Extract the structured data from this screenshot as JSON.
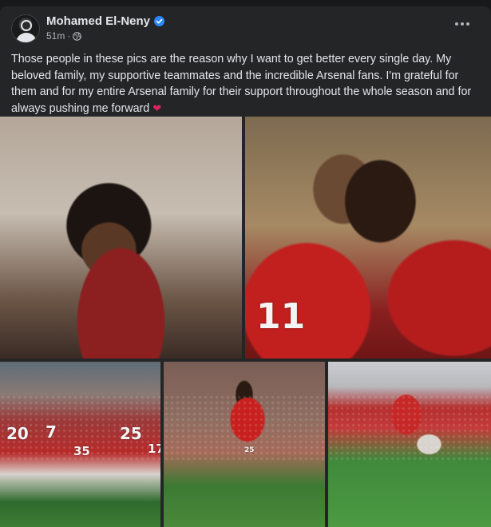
{
  "post": {
    "author": "Mohamed El-Neny",
    "time": "51m",
    "audience_icon": "globe-icon",
    "verified_icon": "verified-badge-icon",
    "text": "Those people in these pics are the reason why I want to get better every single day. My beloved family, my supportive teammates and the incredible Arsenal fans. I'm grateful for them and for my entire Arsenal family for their support throughout the whole season and for always pushing me forward",
    "emoji": "❤",
    "colors": {
      "accent_blue": "#2d88ff",
      "heart": "#e0245e",
      "card_bg": "#242526"
    }
  },
  "photos": {
    "p2_shirt": "11",
    "p3_shirts": [
      "20",
      "7",
      "35",
      "25",
      "17"
    ],
    "p4_shirt": "25"
  }
}
